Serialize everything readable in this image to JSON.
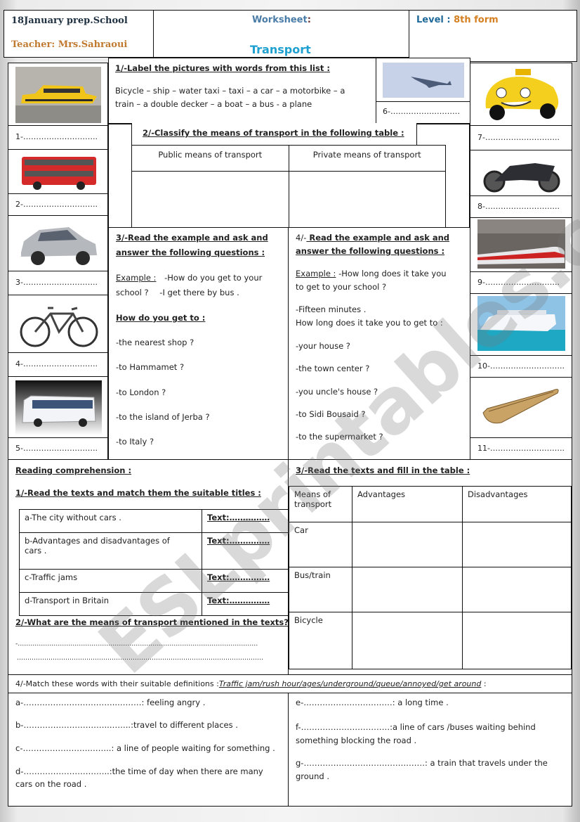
{
  "header": {
    "school": "18January prep.School",
    "teacher": "Teacher: Mrs.Sahraoui",
    "worksheet_label": "Worksheet",
    "worksheet_colon": ":",
    "title": "Transport",
    "level_label": "Level :",
    "level_value": "8th form"
  },
  "colors": {
    "school": "#1f3040",
    "teacher": "#c07a30",
    "worksheet": "#4a7ca8",
    "title": "#1ea0d0",
    "level_label": "#1f6a9a",
    "level_value": "#d58020"
  },
  "ex1": {
    "title": "1/-Label the pictures with words from this list :",
    "line1": "Bicycle – ship – water taxi – taxi – a car – a motorbike – a",
    "line2": "train – a double decker  – a boat – a bus  - a plane"
  },
  "pictures": [
    {
      "num": "1-………………………..",
      "icon": "water-taxi"
    },
    {
      "num": "2-………………………..",
      "icon": "double-decker"
    },
    {
      "num": "3-………………………..",
      "icon": "car"
    },
    {
      "num": "4-………………………..",
      "icon": "bicycle"
    },
    {
      "num": "5-………………………..",
      "icon": "bus"
    },
    {
      "num": "6-………………………",
      "icon": "plane"
    },
    {
      "num": "7-………………………..",
      "icon": "taxi"
    },
    {
      "num": "8-………………………..",
      "icon": "motorbike"
    },
    {
      "num": "9-………………………..",
      "icon": "train"
    },
    {
      "num": "10-………………………..",
      "icon": "ship"
    },
    {
      "num": "11-………………………..",
      "icon": "boat"
    }
  ],
  "ex2": {
    "title": "2/-Classify  the  means of transport  in the following  table :",
    "col1": "Public means of transport",
    "col2": "Private means of transport"
  },
  "ex3": {
    "title1": "3/-Read the example and ask and",
    "title2": "answer  the following  questions :",
    "example_label": "Example :",
    "example_q": "-How do you get to your",
    "example_q2": "school ?",
    "example_a": "-I get there by bus .",
    "subtitle": "How do you get to :",
    "items": [
      "-the  nearest shop ?",
      "-to  Hammamet ?",
      "-to London ?",
      "-to  the  island of Jerba ?",
      "-to Italy ?"
    ]
  },
  "ex4": {
    "num": "4/-",
    "title1": " Read the example and ask and",
    "title2": "answer  the following  questions :",
    "example_label": "Example :",
    "example_q": " -How long does it take you",
    "example_q2": "to get to your school ?",
    "answer": "-Fifteen minutes .",
    "prompt": "How long does it take you to get to :",
    "items": [
      "-your  house ?",
      "-the town center ?",
      "-you uncle's house ?",
      "-to Sidi Bousaid ?",
      "-to the supermarket ?"
    ]
  },
  "reading": {
    "title": "Reading comprehension :",
    "q1": "1/-Read the texts and match them  the suitable titles :",
    "titles": [
      {
        "label": "a-The  city without cars .",
        "text": "Text:……………"
      },
      {
        "label": "b-Advantages and disadvantages  of",
        "label2": "cars .",
        "text": "Text:……………"
      },
      {
        "label": "c-Traffic  jams",
        "text": "Text:……………"
      },
      {
        "label": "d-Transport in Britain",
        "text": "Text:……………"
      }
    ],
    "q2": "2/-What are the means of transport mentioned in the texts?",
    "line1": "-……………………………………………………………………………………………………",
    "line2": "………………………………………………………………………………………………………"
  },
  "fill_table": {
    "title": "3/-Read the texts and fill in the table :",
    "headers": [
      "Means of transport",
      "Advantages",
      "Disadvantages"
    ],
    "header_line1": "Means of",
    "header_line2": "transport",
    "rows": [
      "Car",
      "Bus/train",
      "Bicycle"
    ]
  },
  "vocab": {
    "intro": "4/-Match these words with their suitable definitions :",
    "words": "Traffic jam/rush hour/ages/underground/queue/annoyed/get around",
    "tail": " :",
    "left": [
      {
        "text": "a-……………………………..………: feeling angry ."
      },
      {
        "text": "b-…………………………..……..:travel to different places ."
      },
      {
        "text": "c-…………………….……..: a line of people waiting for something ."
      },
      {
        "text": "d-…………………………..:the time of day when there are many",
        "text2": "cars on the road ."
      }
    ],
    "right": [
      {
        "text": "e-……………………………:  a long time ."
      },
      {
        "text": "f-……………………………:a line of cars /buses waiting behind",
        "text2": "something blocking the road ."
      },
      {
        "text": "g-………………………………………: a train that travels under the",
        "text2": "ground ."
      }
    ]
  },
  "watermark": "ESLprintables.com"
}
